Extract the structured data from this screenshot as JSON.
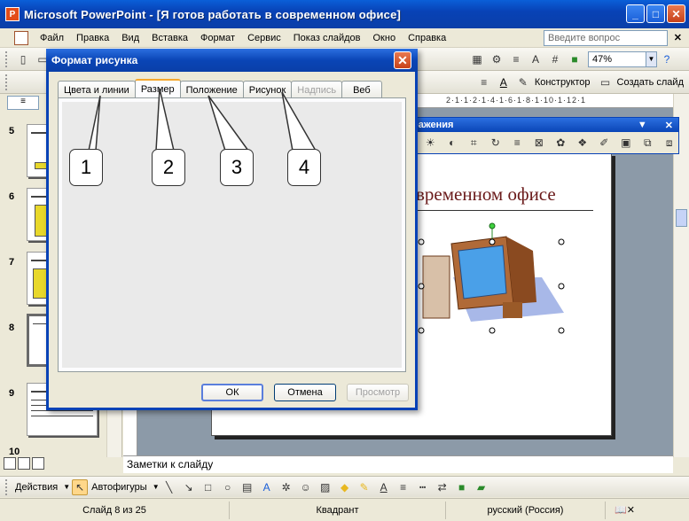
{
  "window": {
    "title": "Microsoft PowerPoint - [Я готов работать в современном офисе]"
  },
  "menu": {
    "items": [
      "Файл",
      "Правка",
      "Вид",
      "Вставка",
      "Формат",
      "Сервис",
      "Показ слайдов",
      "Окно",
      "Справка"
    ],
    "help_placeholder": "Введите вопрос"
  },
  "toolbar": {
    "zoom": "47%",
    "designer_label": "Конструктор",
    "new_slide_label": "Создать слайд"
  },
  "ruler": {
    "ticks": "2·1·1·2·1·4·1·6·1·8·1·10·1·12·1"
  },
  "left_panel": {
    "slides": [
      {
        "num": "5"
      },
      {
        "num": "6"
      },
      {
        "num": "7"
      },
      {
        "num": "8"
      },
      {
        "num": "9"
      },
      {
        "num": "10"
      }
    ]
  },
  "slide": {
    "title": "временном офисе"
  },
  "picture_toolbar": {
    "title": "ражения"
  },
  "dialog": {
    "title": "Формат рисунка",
    "tabs": [
      "Цвета и линии",
      "Размер",
      "Положение",
      "Рисунок",
      "Надпись",
      "Веб"
    ],
    "ok_label": "ОК",
    "cancel_label": "Отмена",
    "preview_label": "Просмотр"
  },
  "callouts": [
    "1",
    "2",
    "3",
    "4"
  ],
  "notes": {
    "label": "Заметки к слайду"
  },
  "drawing": {
    "actions_label": "Действия",
    "autoshapes_label": "Автофигуры"
  },
  "status": {
    "slide": "Слайд 8 из 25",
    "design": "Квадрант",
    "lang": "русский (Россия)"
  }
}
